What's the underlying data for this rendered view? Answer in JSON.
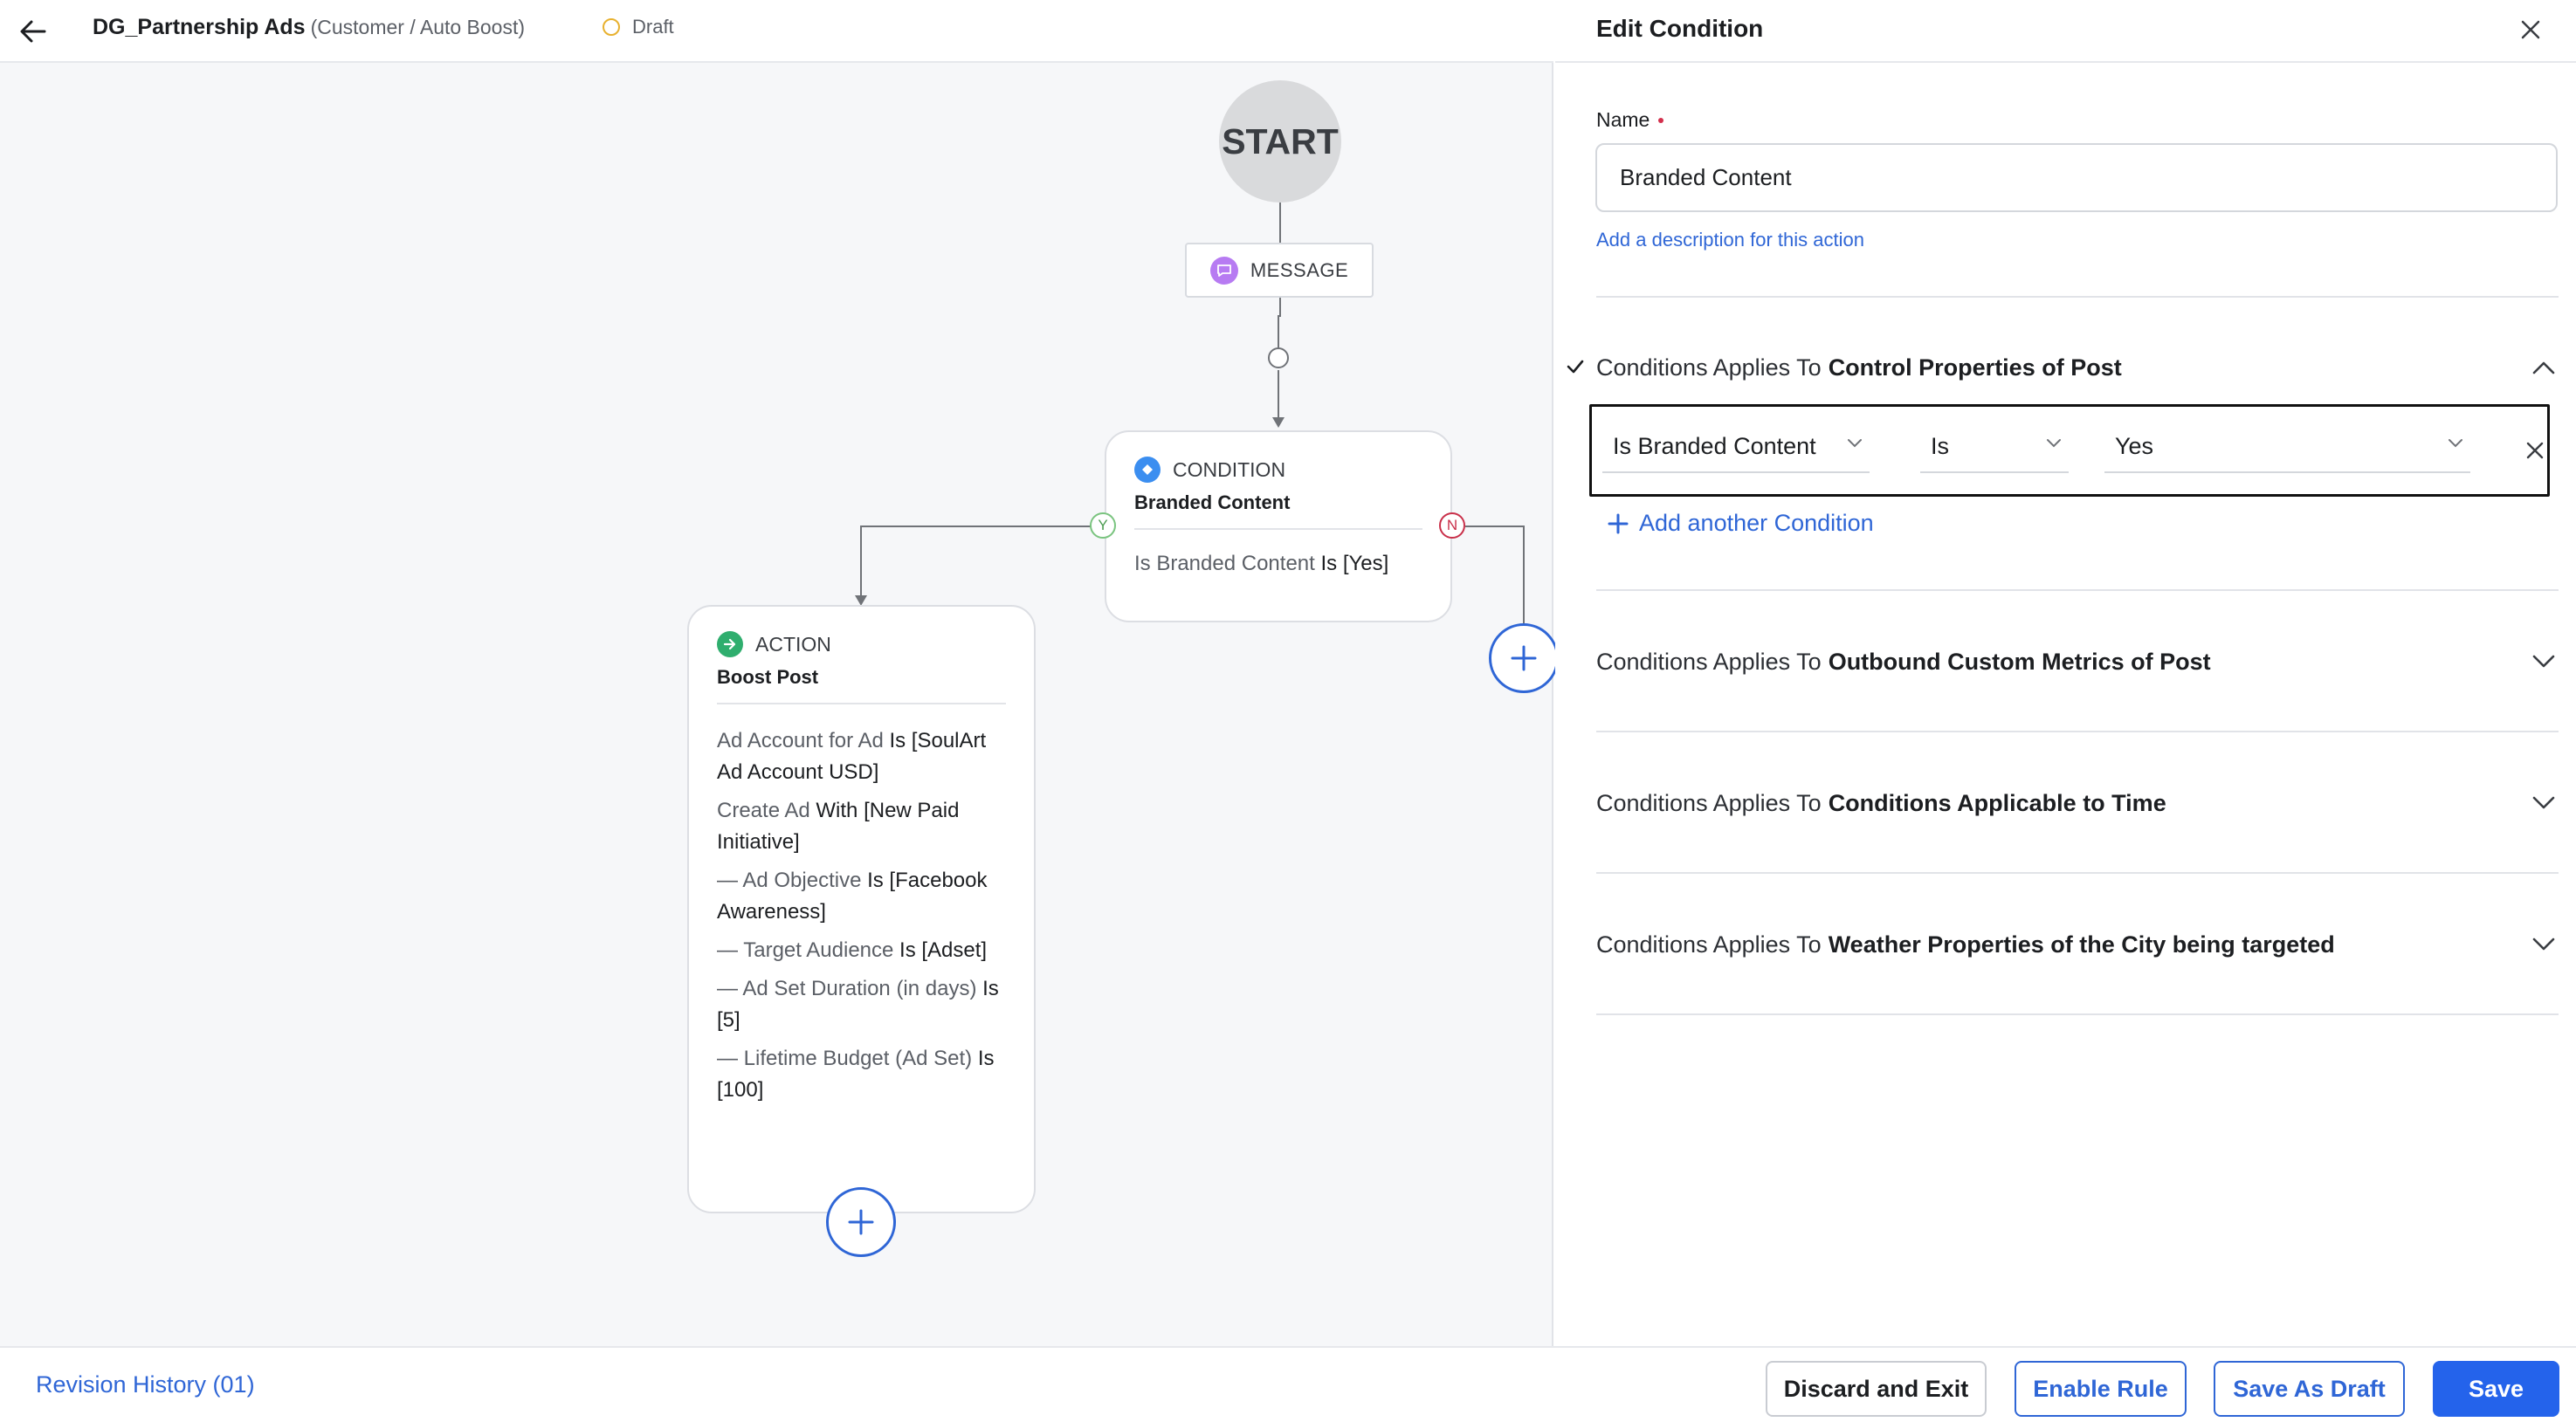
{
  "header": {
    "rule_name": "DG_Partnership Ads",
    "rule_context": "(Customer / Auto Boost)",
    "status": "Draft"
  },
  "canvas": {
    "start_label": "START",
    "message_node": {
      "label": "MESSAGE"
    },
    "condition_node": {
      "type": "CONDITION",
      "name": "Branded Content",
      "rule_key": "Is Branded Content",
      "rule_value": "Is [Yes]",
      "yes_badge": "Y",
      "no_badge": "N"
    },
    "action_node": {
      "type": "ACTION",
      "name": "Boost Post",
      "lines": [
        {
          "key": "Ad Account for Ad",
          "value": "Is [SoulArt Ad Account USD]"
        },
        {
          "key": "Create Ad",
          "value": "With [New Paid Initiative]"
        },
        {
          "key": "— Ad Objective",
          "value": "Is [Facebook Awareness]"
        },
        {
          "key": "— Target Audience",
          "value": "Is [Adset]"
        },
        {
          "key": "— Ad Set Duration (in days)",
          "value": "Is [5]"
        },
        {
          "key": "— Lifetime Budget (Ad Set)",
          "value": "Is [100]"
        }
      ]
    }
  },
  "panel": {
    "title": "Edit Condition",
    "name_label": "Name",
    "name_value": "Branded Content",
    "description_link": "Add a description for this action",
    "sections": [
      {
        "prefix": "Conditions Applies To",
        "title": "Control Properties of Post",
        "expanded": true
      },
      {
        "prefix": "Conditions Applies To",
        "title": "Outbound Custom Metrics of Post",
        "expanded": false
      },
      {
        "prefix": "Conditions Applies To",
        "title": "Conditions Applicable to Time",
        "expanded": false
      },
      {
        "prefix": "Conditions Applies To",
        "title": "Weather Properties of the City being targeted",
        "expanded": false
      }
    ],
    "condition_row": {
      "field": "Is Branded Content",
      "operator": "Is",
      "value": "Yes"
    },
    "add_condition": "Add another Condition"
  },
  "footer": {
    "revision_history": "Revision History (01)",
    "discard": "Discard and Exit",
    "enable": "Enable Rule",
    "save_draft": "Save As Draft",
    "save": "Save"
  },
  "colors": {
    "accent": "#2f66d6",
    "primary_button": "#2463eb",
    "status_draft": "#e8b12f",
    "yes_green": "#4b9b50",
    "no_red": "#c9304a",
    "message_purple": "#b77bf2",
    "condition_blue": "#3b8ef0",
    "action_green": "#2fae6e"
  },
  "icons": [
    "back-arrow-icon",
    "draft-status-icon",
    "message-icon",
    "condition-icon",
    "action-arrow-icon",
    "plus-icon",
    "close-icon",
    "check-icon",
    "chevron-up-icon",
    "chevron-down-icon"
  ]
}
